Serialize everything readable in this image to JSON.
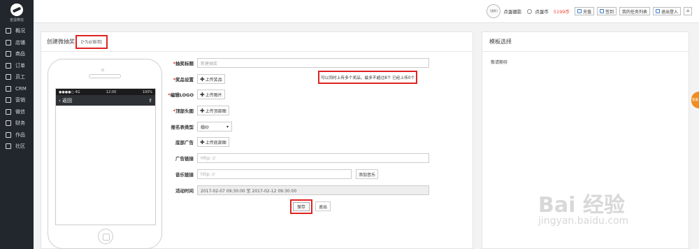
{
  "brand": {
    "logo_text": "金蛋微信"
  },
  "sidebar": {
    "items": [
      {
        "icon": "dashboard-icon",
        "label": "概况"
      },
      {
        "icon": "store-icon",
        "label": "店铺"
      },
      {
        "icon": "goods-icon",
        "label": "商品"
      },
      {
        "icon": "order-icon",
        "label": "订单"
      },
      {
        "icon": "staff-icon",
        "label": "员工"
      },
      {
        "icon": "crm-icon",
        "label": "CRM"
      },
      {
        "icon": "marketing-icon",
        "label": "营销"
      },
      {
        "icon": "wechat-icon",
        "label": "微信"
      },
      {
        "icon": "finance-icon",
        "label": "财务"
      },
      {
        "icon": "works-icon",
        "label": "作品"
      },
      {
        "icon": "community-icon",
        "label": "社区"
      }
    ]
  },
  "topbar": {
    "avatar_text": "[摄影]",
    "username": "点蛋摄影",
    "coin_label": "点蛋币",
    "coin_amount": "5199币",
    "recharge": "充值",
    "checkin": "签到",
    "tasks": "我的任务列表",
    "logout": "退出登入"
  },
  "main": {
    "title": "创建微抽奖",
    "must_note": "【*为必填项】"
  },
  "phone": {
    "carrier": "●●●●○ 4G",
    "time": "12:00",
    "battery": "100%",
    "back_label": "返回"
  },
  "form": {
    "title_label": "抽奖标题",
    "title_placeholder": "新建抽奖",
    "prize_label": "奖品设置",
    "prize_button": "上传奖品",
    "prize_hint": "可以同时上传多个奖品，最多不超过8个 已经上传0个",
    "logo_label": "编辑LOGO",
    "logo_button": "上传图片",
    "top_label": "顶部头图",
    "top_button": "上传顶部图",
    "signup_label": "报名表类型",
    "signup_value": "婚纱",
    "bottom_label": "底部广告",
    "bottom_button": "上传底部图",
    "ad_link_label": "广告链接",
    "ad_link_placeholder": "Http: //",
    "music_label": "音乐链接",
    "music_placeholder": "http: //",
    "add_music": "添加音乐",
    "time_label": "活动时间",
    "time_value": "2017-02-07 09:30:00 至 2017-02-12 09:30:00",
    "save": "保存",
    "exit": "退出"
  },
  "template": {
    "title": "模板选择",
    "empty_text": "敬请期待"
  },
  "float_tab": "客服",
  "watermark": {
    "main": "Bai 经验",
    "sub": "jingyan.baidu.com"
  },
  "colors": {
    "sidebar_bg": "#22272e",
    "highlight_border": "#e02323",
    "coin": "#e43",
    "float_tab": "#f08c22"
  }
}
